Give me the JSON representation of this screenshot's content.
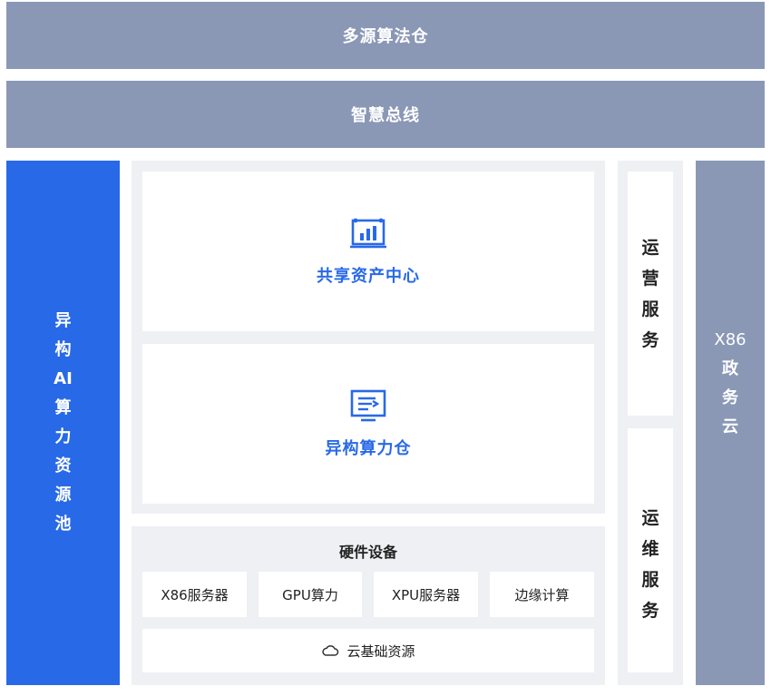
{
  "top_bar": {
    "label": "多源算法仓"
  },
  "bus_bar": {
    "label": "智慧总线"
  },
  "left_column": {
    "lines": [
      "异",
      "构",
      "AI",
      "算",
      "力",
      "资",
      "源",
      "池"
    ]
  },
  "center": {
    "asset_center": {
      "label": "共享资产中心",
      "icon": "analytics-board-icon"
    },
    "compute_warehouse": {
      "label": "异构算力仓",
      "icon": "monitor-list-icon"
    },
    "hardware": {
      "title": "硬件设备",
      "items": [
        "X86服务器",
        "GPU算力",
        "XPU服务器",
        "边缘计算"
      ],
      "cloud": {
        "label": "云基础资源",
        "icon": "cloud-icon"
      }
    }
  },
  "services": {
    "operation": [
      "运",
      "营",
      "服",
      "务"
    ],
    "maintenance": [
      "运",
      "维",
      "服",
      "务"
    ]
  },
  "right_column": {
    "lines": [
      "X86",
      "政",
      "务",
      "云"
    ]
  },
  "colors": {
    "slate": "#8a98b6",
    "blue": "#2869e8",
    "panel_grey": "#eef0f4",
    "text_dark": "#222222"
  }
}
